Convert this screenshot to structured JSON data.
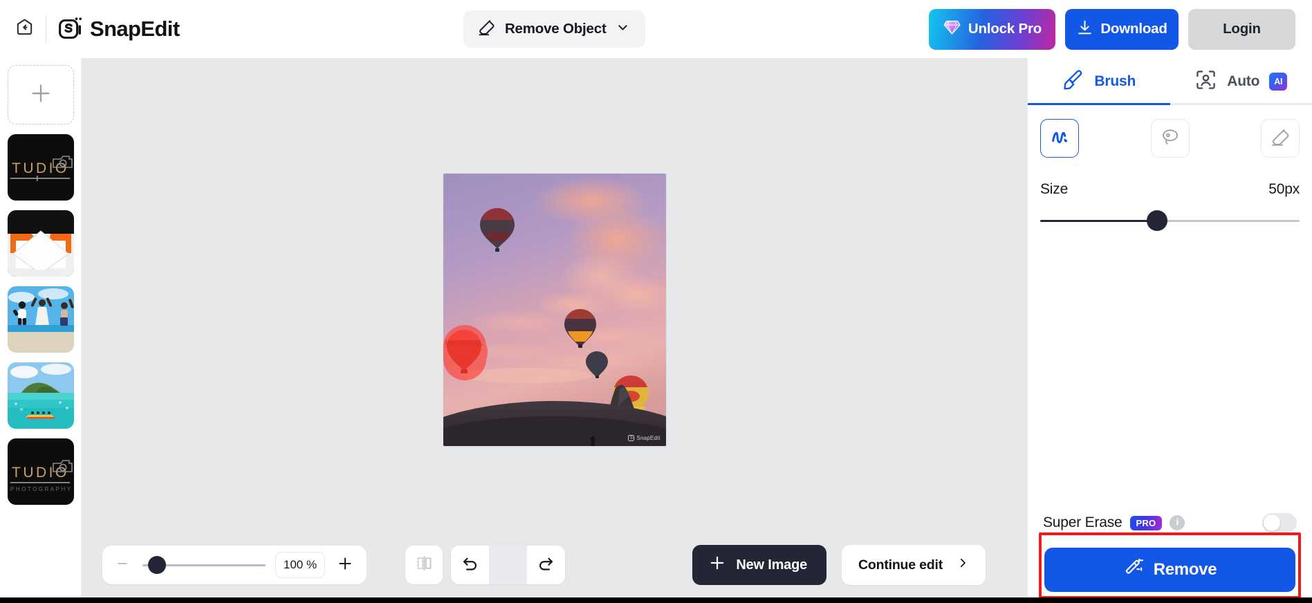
{
  "header": {
    "back_icon": "home-back-icon",
    "brand": "SnapEdit",
    "tool_select": {
      "label": "Remove Object",
      "icon": "eraser-icon",
      "caret": "chevron-down-icon"
    },
    "unlock_pro": {
      "label": "Unlock Pro",
      "icon": "diamond-icon",
      "gradient_from": "#13c6ef",
      "gradient_to": "#c0289f"
    },
    "download": {
      "label": "Download",
      "icon": "download-icon",
      "color": "#1357e6"
    },
    "login": {
      "label": "Login",
      "color": "#d6d7d9"
    }
  },
  "sidebar": {
    "add_label": "+",
    "add_icon": "plus-icon",
    "thumbnails": [
      {
        "name": "studio-logo-dark",
        "caption": "TUDIO"
      },
      {
        "name": "white-envelope-orange"
      },
      {
        "name": "beach-jumping-people"
      },
      {
        "name": "turquoise-bay-canoe"
      },
      {
        "name": "studio-logo-dark-2",
        "caption": "TUDIO"
      }
    ]
  },
  "canvas": {
    "image_name": "hot-air-balloons-sunset",
    "watermark": "SnapEdit",
    "mask_name": "red-brush-mask-over-universal-balloon",
    "zoom": {
      "value": "100 %",
      "minus_icon": "minus-icon",
      "plus_icon": "plus-icon",
      "slider_percent": 8
    },
    "compare_icon": "compare-split-icon",
    "undo_icon": "undo-icon",
    "redo_icon": "redo-icon",
    "new_image": {
      "label": "New Image",
      "icon": "plus-icon"
    },
    "continue_edit": {
      "label": "Continue edit",
      "icon": "chevron-right-icon"
    }
  },
  "panel": {
    "tabs": [
      {
        "label": "Brush",
        "icon": "brush-icon",
        "active": true
      },
      {
        "label": "Auto",
        "icon": "person-frame-icon",
        "badge": "AI",
        "active": false
      }
    ],
    "tools": [
      {
        "name": "scribble-brush-tool",
        "selected": true
      },
      {
        "name": "lasso-tool",
        "selected": false
      },
      {
        "name": "eraser-tool",
        "selected": false
      }
    ],
    "size": {
      "label": "Size",
      "value": "50px",
      "slider_percent": 45
    },
    "super_erase": {
      "label": "Super Erase",
      "badge": "PRO",
      "info_icon": "info-icon",
      "enabled": false
    },
    "remove": {
      "label": "Remove",
      "icon": "magic-wand-icon",
      "color": "#1357e6"
    }
  }
}
